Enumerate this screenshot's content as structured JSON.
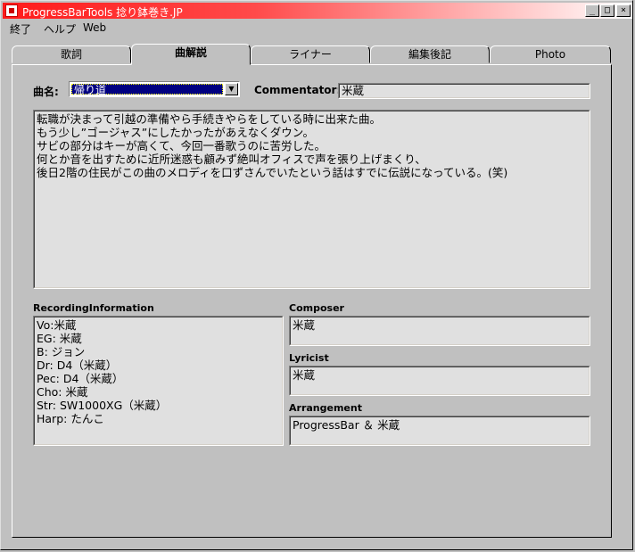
{
  "window": {
    "title": "ProgressBarTools  捻り鉢巻き.JP"
  },
  "menu": [
    "終了",
    "ヘルプ",
    "Web"
  ],
  "tabs": [
    "歌詞",
    "曲解説",
    "ライナー",
    "編集後記",
    "Photo"
  ],
  "active_tab": "曲解説",
  "song": {
    "label": "曲名:",
    "selected": "帰り道"
  },
  "commentator": {
    "label": "Commentator:",
    "value": "米蔵"
  },
  "description": "転職が決まって引越の準備やら手続きやらをしている時に出来た曲。\nもう少し”ゴージャス”にしたかったがあえなくダウン。\nサビの部分はキーが高くて、今回一番歌うのに苦労した。\n何とか音を出すために近所迷惑も顧みず絶叫オフィスで声を張り上げまくり、\n後日2階の住民がこの曲のメロディを口ずさんでいたという話はすでに伝説になっている。(笑)",
  "recording": {
    "label": "RecordingInformation",
    "lines": "Vo:米蔵\nEG: 米蔵\nB: ジョン\nDr: D4（米蔵）\nPec: D4（米蔵）\nCho: 米蔵\nStr: SW1000XG（米蔵）\nHarp: たんこ"
  },
  "composer": {
    "label": "Composer",
    "value": "米蔵"
  },
  "lyricist": {
    "label": "Lyricist",
    "value": "米蔵"
  },
  "arrangement": {
    "label": "Arrangement",
    "value": "ProgressBar ＆ 米蔵"
  },
  "icons": {
    "dropdown": "chevron-down-icon",
    "minimize": "minimize-icon",
    "maximize": "maximize-icon",
    "close": "close-icon"
  }
}
